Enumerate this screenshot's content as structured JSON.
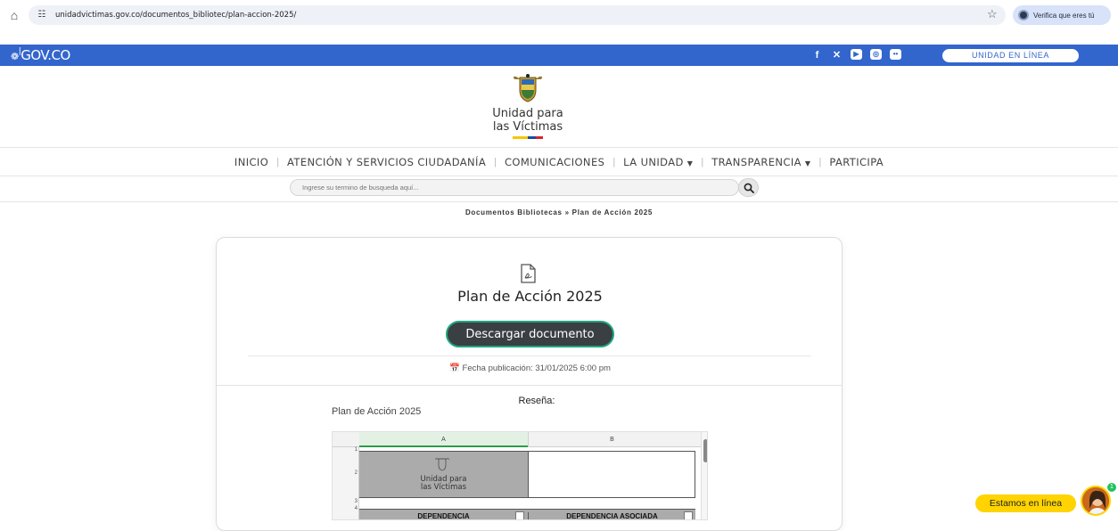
{
  "browser": {
    "url": "unidadvictimas.gov.co/documentos_bibliotec/plan-accion-2025/",
    "verify_label": "Verifica que eres tú"
  },
  "gov_bar": {
    "logo_text": "GOV.CO",
    "social_icons": [
      "facebook-icon",
      "x-icon",
      "youtube-icon",
      "instagram-icon",
      "flickr-icon"
    ],
    "unidad_button": "UNIDAD EN LÍNEA",
    "color": "#3366cc"
  },
  "brand": {
    "line1": "Unidad para",
    "line2": "las Víctimas",
    "flag_colors": [
      "#f6c500",
      "#1d4ba0",
      "#d9242b"
    ]
  },
  "nav": {
    "items": [
      {
        "label": "INICIO"
      },
      {
        "label": "ATENCIÓN Y SERVICIOS CIUDADANÍA"
      },
      {
        "label": "COMUNICACIONES"
      },
      {
        "label": "LA UNIDAD",
        "dropdown": true
      },
      {
        "label": "TRANSPARENCIA",
        "dropdown": true
      },
      {
        "label": "PARTICIPA"
      }
    ]
  },
  "search": {
    "placeholder": "Ingrese su termino de busqueda aquí..."
  },
  "breadcrumb": "Documentos Bibliotecas » Plan de Acción 2025",
  "document": {
    "title": "Plan de Acción 2025",
    "download_label": "Descargar documento",
    "fecha": "Fecha publicación: 31/01/2025 6:00 pm",
    "resena_label": "Reseña:",
    "resena_text": "Plan de Acción 2025",
    "accent_color": "#1fa77f"
  },
  "sheet": {
    "columns": [
      "A",
      "B"
    ],
    "rows": [
      "1",
      "2",
      "3",
      "4"
    ],
    "logo_line1": "Unidad para",
    "logo_line2": "las Víctimas",
    "header_a": "DEPENDENCIA",
    "header_b": "DEPENDENCIA ASOCIADA"
  },
  "chat": {
    "label": "Estamos en línea",
    "badge": "1",
    "color": "#ffd400"
  }
}
